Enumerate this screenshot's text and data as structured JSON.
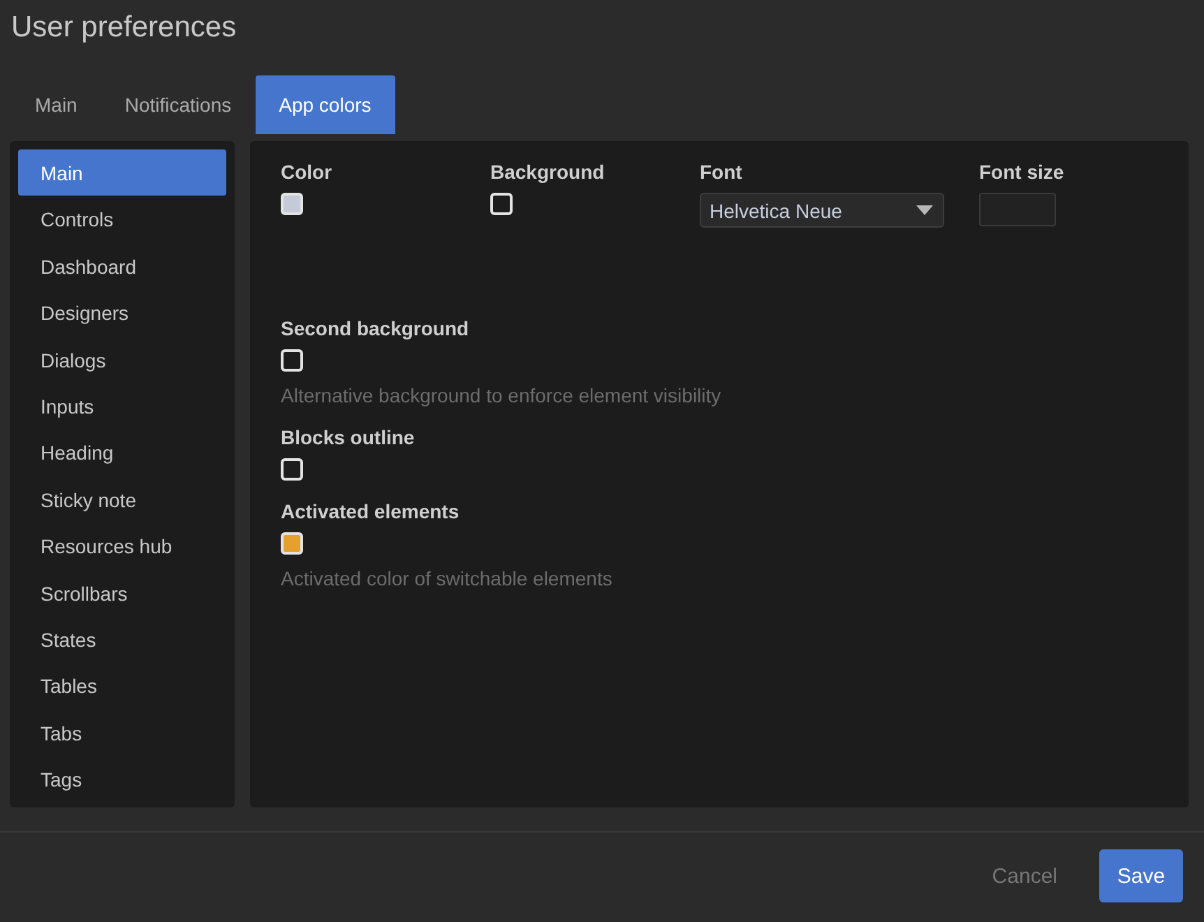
{
  "window": {
    "title": "User preferences"
  },
  "tabs": [
    {
      "label": "Main",
      "selected": false
    },
    {
      "label": "Notifications",
      "selected": false
    },
    {
      "label": "App colors",
      "selected": true
    }
  ],
  "sidebar": {
    "items": [
      {
        "label": "Main",
        "selected": true
      },
      {
        "label": "Controls",
        "selected": false
      },
      {
        "label": "Dashboard",
        "selected": false
      },
      {
        "label": "Designers",
        "selected": false
      },
      {
        "label": "Dialogs",
        "selected": false
      },
      {
        "label": "Inputs",
        "selected": false
      },
      {
        "label": "Heading",
        "selected": false
      },
      {
        "label": "Sticky note",
        "selected": false
      },
      {
        "label": "Resources hub",
        "selected": false
      },
      {
        "label": "Scrollbars",
        "selected": false
      },
      {
        "label": "States",
        "selected": false
      },
      {
        "label": "Tables",
        "selected": false
      },
      {
        "label": "Tabs",
        "selected": false
      },
      {
        "label": "Tags",
        "selected": false
      }
    ]
  },
  "top_fields": [
    {
      "kind": "color",
      "label": "Color",
      "color": "#c5cad8"
    },
    {
      "kind": "color",
      "label": "Background",
      "color": "#1c1c1c"
    },
    {
      "kind": "select",
      "label": "Font",
      "value": "Helvetica Neue"
    },
    {
      "kind": "input",
      "label": "Font size"
    }
  ],
  "settings": [
    {
      "label": "Second background",
      "color": "#1c1c1c",
      "hint": "Alternative background to enforce element visibility"
    },
    {
      "label": "Blocks outline",
      "color": "#1c1c1c"
    },
    {
      "label": "Activated elements",
      "color": "#e8a02c",
      "hint": "Activated color of switchable elements"
    }
  ],
  "buttons": [
    {
      "label": "Cancel",
      "kind": "secondary"
    },
    {
      "label": "Save",
      "kind": "primary"
    }
  ]
}
